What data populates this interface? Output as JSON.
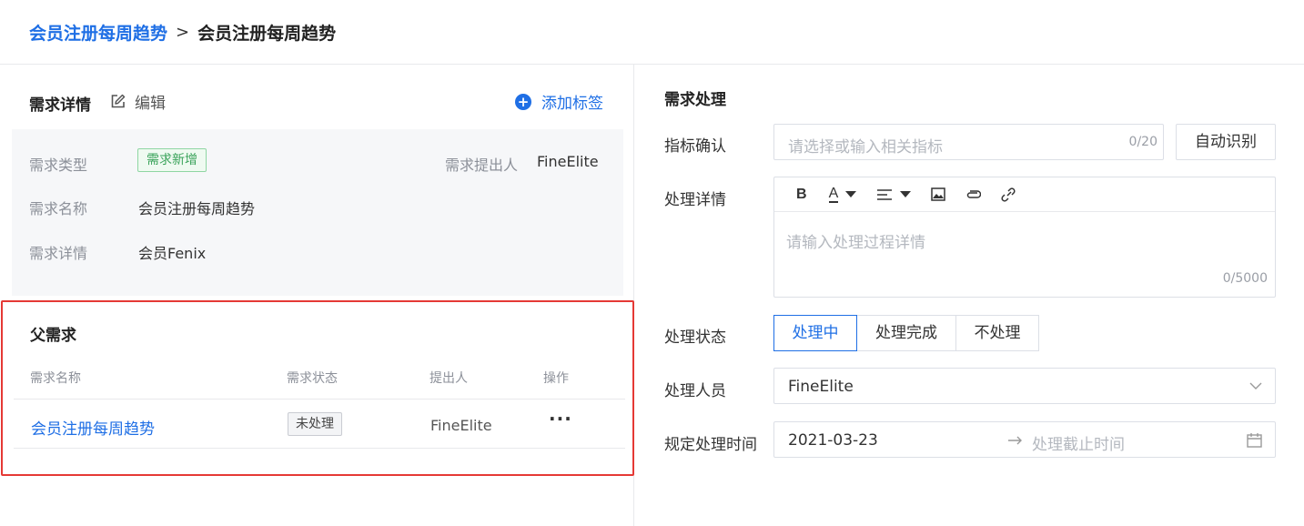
{
  "breadcrumb": {
    "parent": "会员注册每周趋势",
    "separator": ">",
    "current": "会员注册每周趋势"
  },
  "detail": {
    "title": "需求详情",
    "edit_label": "编辑",
    "add_tag_label": "添加标签",
    "fields": {
      "type_label": "需求类型",
      "type_value": "需求新增",
      "submitter_label": "需求提出人",
      "submitter_value": "FineElite",
      "name_label": "需求名称",
      "name_value": "会员注册每周趋势",
      "desc_label": "需求详情",
      "desc_value": "会员Fenix"
    }
  },
  "parent": {
    "title": "父需求",
    "columns": {
      "name": "需求名称",
      "status": "需求状态",
      "person": "提出人",
      "action": "操作"
    },
    "rows": [
      {
        "name": "会员注册每周趋势",
        "status": "未处理",
        "person": "FineElite",
        "action": "···"
      }
    ]
  },
  "processing": {
    "title": "需求处理",
    "metric_label": "指标确认",
    "metric_placeholder": "请选择或输入相关指标",
    "metric_counter": "0/20",
    "auto_button": "自动识别",
    "detail_label": "处理详情",
    "detail_placeholder": "请输入处理过程详情",
    "detail_counter": "0/5000",
    "toolbar": {
      "bold": "B",
      "font_color": "A"
    },
    "status_label": "处理状态",
    "status_options": [
      "处理中",
      "处理完成",
      "不处理"
    ],
    "status_selected": "处理中",
    "handler_label": "处理人员",
    "handler_value": "FineElite",
    "time_label": "规定处理时间",
    "start_date": "2021-03-23",
    "end_placeholder": "处理截止时间"
  },
  "colors": {
    "accent": "#1f6fe5",
    "highlight_border": "#e53935",
    "tag_green": "#3aa35a"
  }
}
